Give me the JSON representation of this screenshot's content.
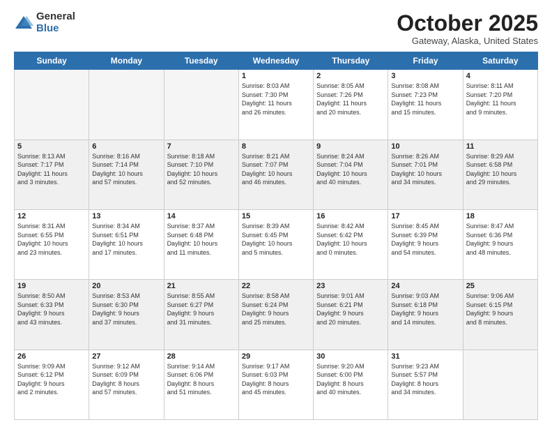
{
  "logo": {
    "general": "General",
    "blue": "Blue"
  },
  "header": {
    "month": "October 2025",
    "location": "Gateway, Alaska, United States"
  },
  "weekdays": [
    "Sunday",
    "Monday",
    "Tuesday",
    "Wednesday",
    "Thursday",
    "Friday",
    "Saturday"
  ],
  "weeks": [
    [
      {
        "day": "",
        "info": ""
      },
      {
        "day": "",
        "info": ""
      },
      {
        "day": "",
        "info": ""
      },
      {
        "day": "1",
        "info": "Sunrise: 8:03 AM\nSunset: 7:30 PM\nDaylight: 11 hours\nand 26 minutes."
      },
      {
        "day": "2",
        "info": "Sunrise: 8:05 AM\nSunset: 7:26 PM\nDaylight: 11 hours\nand 20 minutes."
      },
      {
        "day": "3",
        "info": "Sunrise: 8:08 AM\nSunset: 7:23 PM\nDaylight: 11 hours\nand 15 minutes."
      },
      {
        "day": "4",
        "info": "Sunrise: 8:11 AM\nSunset: 7:20 PM\nDaylight: 11 hours\nand 9 minutes."
      }
    ],
    [
      {
        "day": "5",
        "info": "Sunrise: 8:13 AM\nSunset: 7:17 PM\nDaylight: 11 hours\nand 3 minutes."
      },
      {
        "day": "6",
        "info": "Sunrise: 8:16 AM\nSunset: 7:14 PM\nDaylight: 10 hours\nand 57 minutes."
      },
      {
        "day": "7",
        "info": "Sunrise: 8:18 AM\nSunset: 7:10 PM\nDaylight: 10 hours\nand 52 minutes."
      },
      {
        "day": "8",
        "info": "Sunrise: 8:21 AM\nSunset: 7:07 PM\nDaylight: 10 hours\nand 46 minutes."
      },
      {
        "day": "9",
        "info": "Sunrise: 8:24 AM\nSunset: 7:04 PM\nDaylight: 10 hours\nand 40 minutes."
      },
      {
        "day": "10",
        "info": "Sunrise: 8:26 AM\nSunset: 7:01 PM\nDaylight: 10 hours\nand 34 minutes."
      },
      {
        "day": "11",
        "info": "Sunrise: 8:29 AM\nSunset: 6:58 PM\nDaylight: 10 hours\nand 29 minutes."
      }
    ],
    [
      {
        "day": "12",
        "info": "Sunrise: 8:31 AM\nSunset: 6:55 PM\nDaylight: 10 hours\nand 23 minutes."
      },
      {
        "day": "13",
        "info": "Sunrise: 8:34 AM\nSunset: 6:51 PM\nDaylight: 10 hours\nand 17 minutes."
      },
      {
        "day": "14",
        "info": "Sunrise: 8:37 AM\nSunset: 6:48 PM\nDaylight: 10 hours\nand 11 minutes."
      },
      {
        "day": "15",
        "info": "Sunrise: 8:39 AM\nSunset: 6:45 PM\nDaylight: 10 hours\nand 5 minutes."
      },
      {
        "day": "16",
        "info": "Sunrise: 8:42 AM\nSunset: 6:42 PM\nDaylight: 10 hours\nand 0 minutes."
      },
      {
        "day": "17",
        "info": "Sunrise: 8:45 AM\nSunset: 6:39 PM\nDaylight: 9 hours\nand 54 minutes."
      },
      {
        "day": "18",
        "info": "Sunrise: 8:47 AM\nSunset: 6:36 PM\nDaylight: 9 hours\nand 48 minutes."
      }
    ],
    [
      {
        "day": "19",
        "info": "Sunrise: 8:50 AM\nSunset: 6:33 PM\nDaylight: 9 hours\nand 43 minutes."
      },
      {
        "day": "20",
        "info": "Sunrise: 8:53 AM\nSunset: 6:30 PM\nDaylight: 9 hours\nand 37 minutes."
      },
      {
        "day": "21",
        "info": "Sunrise: 8:55 AM\nSunset: 6:27 PM\nDaylight: 9 hours\nand 31 minutes."
      },
      {
        "day": "22",
        "info": "Sunrise: 8:58 AM\nSunset: 6:24 PM\nDaylight: 9 hours\nand 25 minutes."
      },
      {
        "day": "23",
        "info": "Sunrise: 9:01 AM\nSunset: 6:21 PM\nDaylight: 9 hours\nand 20 minutes."
      },
      {
        "day": "24",
        "info": "Sunrise: 9:03 AM\nSunset: 6:18 PM\nDaylight: 9 hours\nand 14 minutes."
      },
      {
        "day": "25",
        "info": "Sunrise: 9:06 AM\nSunset: 6:15 PM\nDaylight: 9 hours\nand 8 minutes."
      }
    ],
    [
      {
        "day": "26",
        "info": "Sunrise: 9:09 AM\nSunset: 6:12 PM\nDaylight: 9 hours\nand 2 minutes."
      },
      {
        "day": "27",
        "info": "Sunrise: 9:12 AM\nSunset: 6:09 PM\nDaylight: 8 hours\nand 57 minutes."
      },
      {
        "day": "28",
        "info": "Sunrise: 9:14 AM\nSunset: 6:06 PM\nDaylight: 8 hours\nand 51 minutes."
      },
      {
        "day": "29",
        "info": "Sunrise: 9:17 AM\nSunset: 6:03 PM\nDaylight: 8 hours\nand 45 minutes."
      },
      {
        "day": "30",
        "info": "Sunrise: 9:20 AM\nSunset: 6:00 PM\nDaylight: 8 hours\nand 40 minutes."
      },
      {
        "day": "31",
        "info": "Sunrise: 9:23 AM\nSunset: 5:57 PM\nDaylight: 8 hours\nand 34 minutes."
      },
      {
        "day": "",
        "info": ""
      }
    ]
  ]
}
